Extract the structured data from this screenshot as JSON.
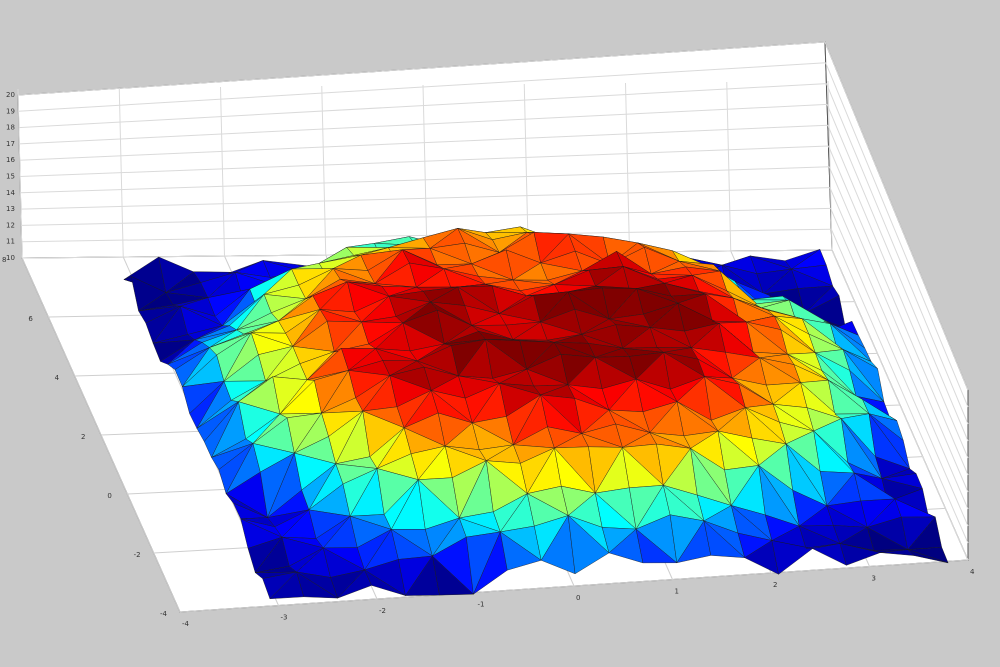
{
  "chart_data": {
    "type": "surface",
    "title": "",
    "xlabel": "",
    "ylabel": "",
    "zlabel": "",
    "colormap": "jet",
    "background_color": "#c9c9c9",
    "axes_color": "#ffffff",
    "grid": true,
    "x_ticks": [
      "-4",
      "-3",
      "-2",
      "-1",
      "0",
      "1",
      "2",
      "3",
      "4"
    ],
    "y_ticks": [
      "-4",
      "-2",
      "0",
      "2",
      "4",
      "6",
      "8"
    ],
    "z_ticks": [
      "10",
      "11",
      "12",
      "13",
      "14",
      "15",
      "16",
      "17",
      "18",
      "19",
      "20"
    ],
    "xlim": [
      -4,
      4
    ],
    "ylim": [
      -4,
      9
    ],
    "zlim": [
      10,
      20
    ],
    "grid_size": 21,
    "z_range": [
      10,
      16.5
    ],
    "peak": {
      "x": 0,
      "y": 2,
      "z": 16.5
    }
  }
}
